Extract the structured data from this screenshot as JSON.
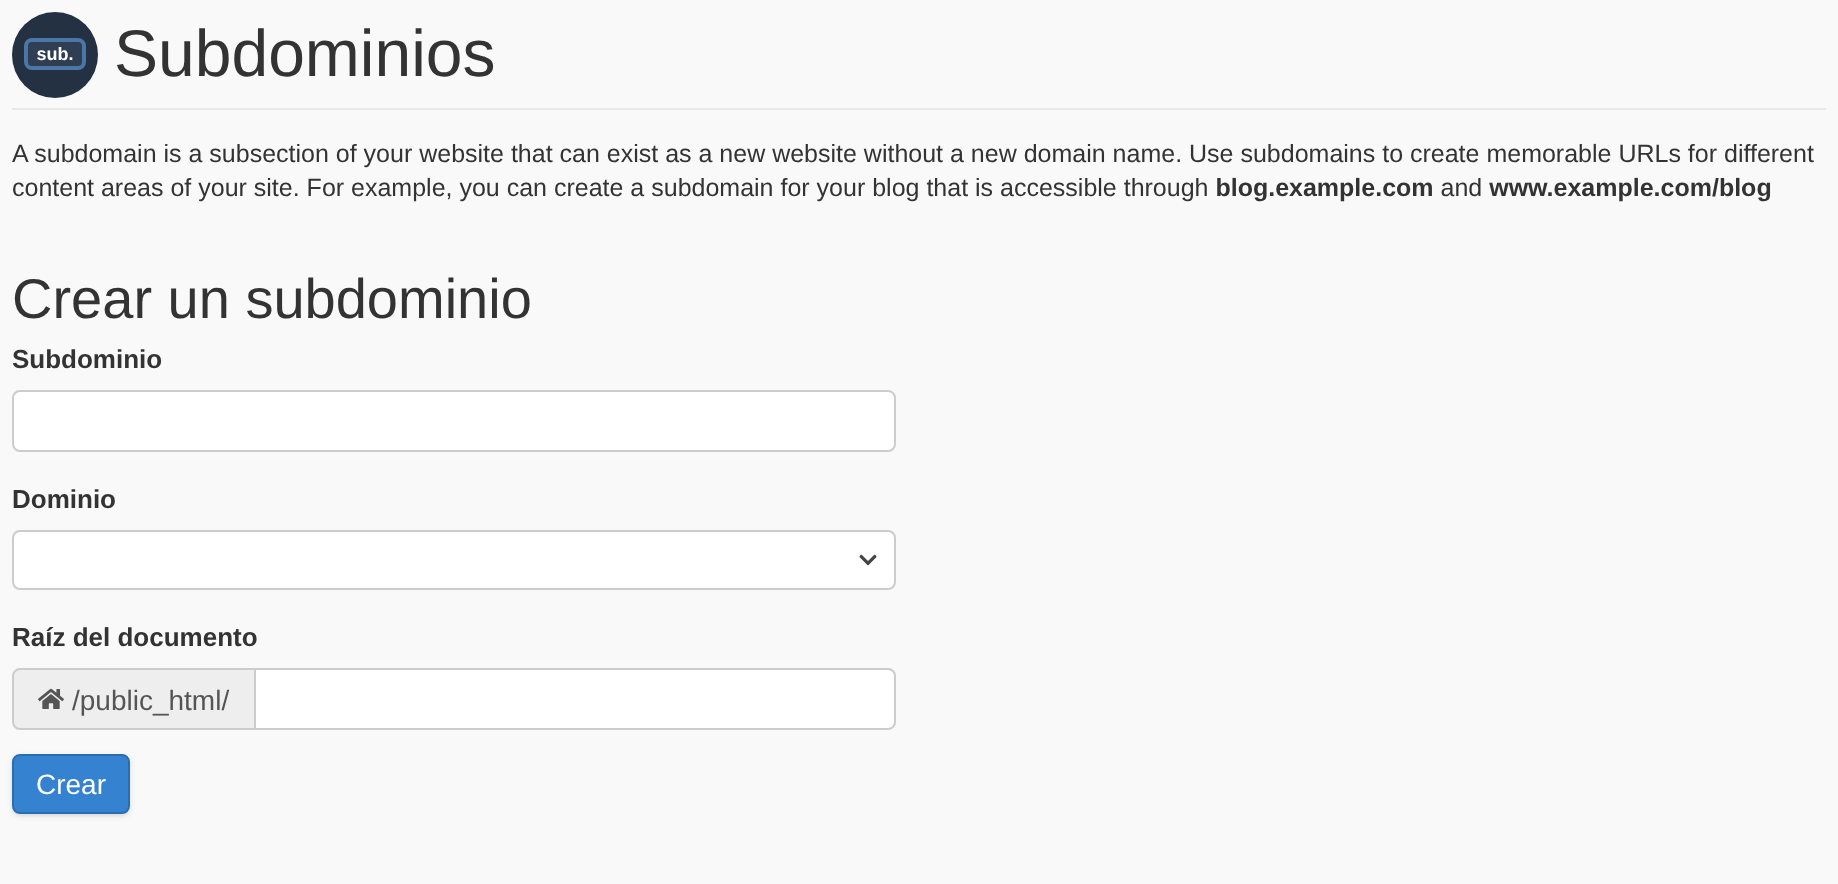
{
  "header": {
    "logo_text": "sub.",
    "title": "Subdominios"
  },
  "description": "A subdomain is a subsection of your website that can exist as a new website without a new domain name. Use subdomains to create memorable URLs for different content areas of your site. For example, you can create a subdomain for your blog that is accessible through **blog.example.com** and **www.example.com/blog**",
  "form": {
    "title": "Crear un subdominio",
    "fields": [
      {
        "kind": "text",
        "label": "Subdominio"
      },
      {
        "kind": "select",
        "label": "Dominio"
      },
      {
        "kind": "prefixed",
        "label": "Raíz del documento",
        "prefix": "/public_html/"
      }
    ],
    "submit": "Crear"
  }
}
